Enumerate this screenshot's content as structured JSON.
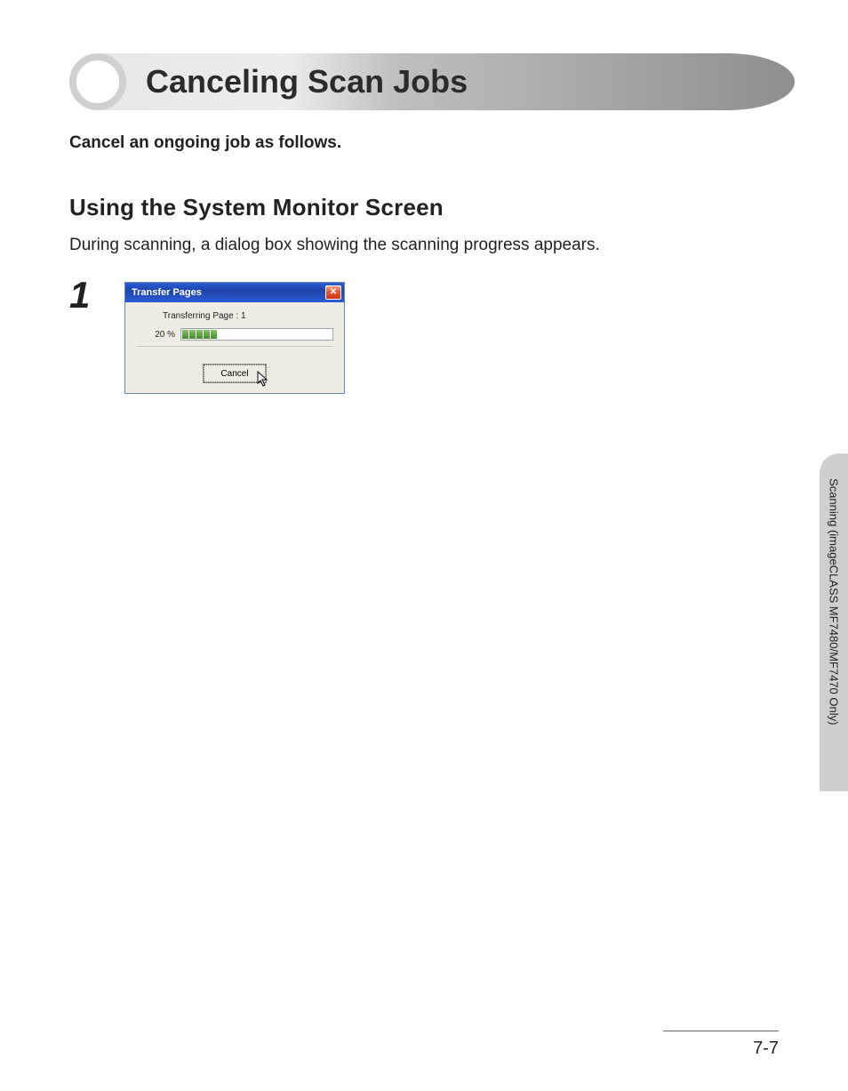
{
  "title": "Canceling Scan Jobs",
  "intro": "Cancel an ongoing job as follows.",
  "section_heading": "Using the System Monitor Screen",
  "section_body": "During scanning, a dialog box showing the scanning progress appears.",
  "step_number": "1",
  "dialog": {
    "title": "Transfer Pages",
    "close_glyph": "✕",
    "line": "Transferring Page :   1",
    "percent": "20 %",
    "cancel_label": "Cancel"
  },
  "side_tab": "Scanning (imageCLASS MF7480/MF7470 Only)",
  "page_number": "7-7"
}
